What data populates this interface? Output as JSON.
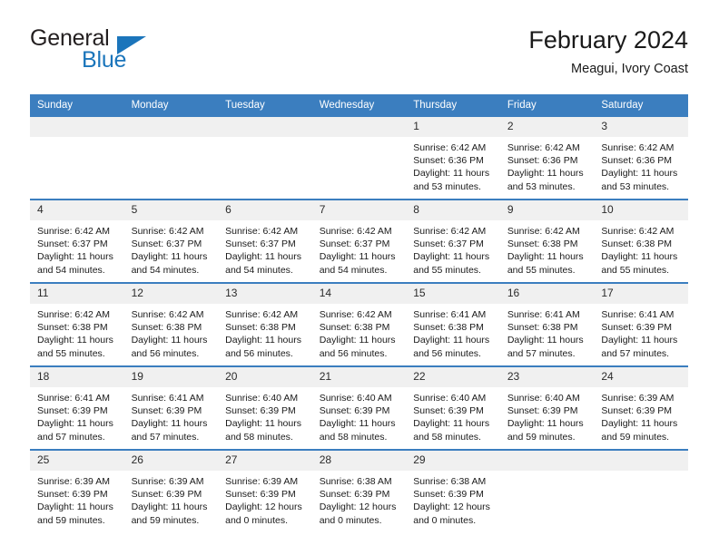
{
  "brand": {
    "name_part1": "General",
    "name_part2": "Blue",
    "accent_color": "#1b75bb",
    "triangle_icon": "triangle-right-icon"
  },
  "header": {
    "month_title": "February 2024",
    "location": "Meagui, Ivory Coast"
  },
  "calendar": {
    "header_bg": "#3b7ebf",
    "daynum_bg": "#f0f0f0",
    "weekday_headers": [
      "Sunday",
      "Monday",
      "Tuesday",
      "Wednesday",
      "Thursday",
      "Friday",
      "Saturday"
    ],
    "weeks": [
      [
        {
          "day": "",
          "empty": true
        },
        {
          "day": "",
          "empty": true
        },
        {
          "day": "",
          "empty": true
        },
        {
          "day": "",
          "empty": true
        },
        {
          "day": "1",
          "sunrise": "Sunrise: 6:42 AM",
          "sunset": "Sunset: 6:36 PM",
          "daylight_line1": "Daylight: 11 hours",
          "daylight_line2": "and 53 minutes."
        },
        {
          "day": "2",
          "sunrise": "Sunrise: 6:42 AM",
          "sunset": "Sunset: 6:36 PM",
          "daylight_line1": "Daylight: 11 hours",
          "daylight_line2": "and 53 minutes."
        },
        {
          "day": "3",
          "sunrise": "Sunrise: 6:42 AM",
          "sunset": "Sunset: 6:36 PM",
          "daylight_line1": "Daylight: 11 hours",
          "daylight_line2": "and 53 minutes."
        }
      ],
      [
        {
          "day": "4",
          "sunrise": "Sunrise: 6:42 AM",
          "sunset": "Sunset: 6:37 PM",
          "daylight_line1": "Daylight: 11 hours",
          "daylight_line2": "and 54 minutes."
        },
        {
          "day": "5",
          "sunrise": "Sunrise: 6:42 AM",
          "sunset": "Sunset: 6:37 PM",
          "daylight_line1": "Daylight: 11 hours",
          "daylight_line2": "and 54 minutes."
        },
        {
          "day": "6",
          "sunrise": "Sunrise: 6:42 AM",
          "sunset": "Sunset: 6:37 PM",
          "daylight_line1": "Daylight: 11 hours",
          "daylight_line2": "and 54 minutes."
        },
        {
          "day": "7",
          "sunrise": "Sunrise: 6:42 AM",
          "sunset": "Sunset: 6:37 PM",
          "daylight_line1": "Daylight: 11 hours",
          "daylight_line2": "and 54 minutes."
        },
        {
          "day": "8",
          "sunrise": "Sunrise: 6:42 AM",
          "sunset": "Sunset: 6:37 PM",
          "daylight_line1": "Daylight: 11 hours",
          "daylight_line2": "and 55 minutes."
        },
        {
          "day": "9",
          "sunrise": "Sunrise: 6:42 AM",
          "sunset": "Sunset: 6:38 PM",
          "daylight_line1": "Daylight: 11 hours",
          "daylight_line2": "and 55 minutes."
        },
        {
          "day": "10",
          "sunrise": "Sunrise: 6:42 AM",
          "sunset": "Sunset: 6:38 PM",
          "daylight_line1": "Daylight: 11 hours",
          "daylight_line2": "and 55 minutes."
        }
      ],
      [
        {
          "day": "11",
          "sunrise": "Sunrise: 6:42 AM",
          "sunset": "Sunset: 6:38 PM",
          "daylight_line1": "Daylight: 11 hours",
          "daylight_line2": "and 55 minutes."
        },
        {
          "day": "12",
          "sunrise": "Sunrise: 6:42 AM",
          "sunset": "Sunset: 6:38 PM",
          "daylight_line1": "Daylight: 11 hours",
          "daylight_line2": "and 56 minutes."
        },
        {
          "day": "13",
          "sunrise": "Sunrise: 6:42 AM",
          "sunset": "Sunset: 6:38 PM",
          "daylight_line1": "Daylight: 11 hours",
          "daylight_line2": "and 56 minutes."
        },
        {
          "day": "14",
          "sunrise": "Sunrise: 6:42 AM",
          "sunset": "Sunset: 6:38 PM",
          "daylight_line1": "Daylight: 11 hours",
          "daylight_line2": "and 56 minutes."
        },
        {
          "day": "15",
          "sunrise": "Sunrise: 6:41 AM",
          "sunset": "Sunset: 6:38 PM",
          "daylight_line1": "Daylight: 11 hours",
          "daylight_line2": "and 56 minutes."
        },
        {
          "day": "16",
          "sunrise": "Sunrise: 6:41 AM",
          "sunset": "Sunset: 6:38 PM",
          "daylight_line1": "Daylight: 11 hours",
          "daylight_line2": "and 57 minutes."
        },
        {
          "day": "17",
          "sunrise": "Sunrise: 6:41 AM",
          "sunset": "Sunset: 6:39 PM",
          "daylight_line1": "Daylight: 11 hours",
          "daylight_line2": "and 57 minutes."
        }
      ],
      [
        {
          "day": "18",
          "sunrise": "Sunrise: 6:41 AM",
          "sunset": "Sunset: 6:39 PM",
          "daylight_line1": "Daylight: 11 hours",
          "daylight_line2": "and 57 minutes."
        },
        {
          "day": "19",
          "sunrise": "Sunrise: 6:41 AM",
          "sunset": "Sunset: 6:39 PM",
          "daylight_line1": "Daylight: 11 hours",
          "daylight_line2": "and 57 minutes."
        },
        {
          "day": "20",
          "sunrise": "Sunrise: 6:40 AM",
          "sunset": "Sunset: 6:39 PM",
          "daylight_line1": "Daylight: 11 hours",
          "daylight_line2": "and 58 minutes."
        },
        {
          "day": "21",
          "sunrise": "Sunrise: 6:40 AM",
          "sunset": "Sunset: 6:39 PM",
          "daylight_line1": "Daylight: 11 hours",
          "daylight_line2": "and 58 minutes."
        },
        {
          "day": "22",
          "sunrise": "Sunrise: 6:40 AM",
          "sunset": "Sunset: 6:39 PM",
          "daylight_line1": "Daylight: 11 hours",
          "daylight_line2": "and 58 minutes."
        },
        {
          "day": "23",
          "sunrise": "Sunrise: 6:40 AM",
          "sunset": "Sunset: 6:39 PM",
          "daylight_line1": "Daylight: 11 hours",
          "daylight_line2": "and 59 minutes."
        },
        {
          "day": "24",
          "sunrise": "Sunrise: 6:39 AM",
          "sunset": "Sunset: 6:39 PM",
          "daylight_line1": "Daylight: 11 hours",
          "daylight_line2": "and 59 minutes."
        }
      ],
      [
        {
          "day": "25",
          "sunrise": "Sunrise: 6:39 AM",
          "sunset": "Sunset: 6:39 PM",
          "daylight_line1": "Daylight: 11 hours",
          "daylight_line2": "and 59 minutes."
        },
        {
          "day": "26",
          "sunrise": "Sunrise: 6:39 AM",
          "sunset": "Sunset: 6:39 PM",
          "daylight_line1": "Daylight: 11 hours",
          "daylight_line2": "and 59 minutes."
        },
        {
          "day": "27",
          "sunrise": "Sunrise: 6:39 AM",
          "sunset": "Sunset: 6:39 PM",
          "daylight_line1": "Daylight: 12 hours",
          "daylight_line2": "and 0 minutes."
        },
        {
          "day": "28",
          "sunrise": "Sunrise: 6:38 AM",
          "sunset": "Sunset: 6:39 PM",
          "daylight_line1": "Daylight: 12 hours",
          "daylight_line2": "and 0 minutes."
        },
        {
          "day": "29",
          "sunrise": "Sunrise: 6:38 AM",
          "sunset": "Sunset: 6:39 PM",
          "daylight_line1": "Daylight: 12 hours",
          "daylight_line2": "and 0 minutes."
        },
        {
          "day": "",
          "empty": true
        },
        {
          "day": "",
          "empty": true
        }
      ]
    ]
  }
}
